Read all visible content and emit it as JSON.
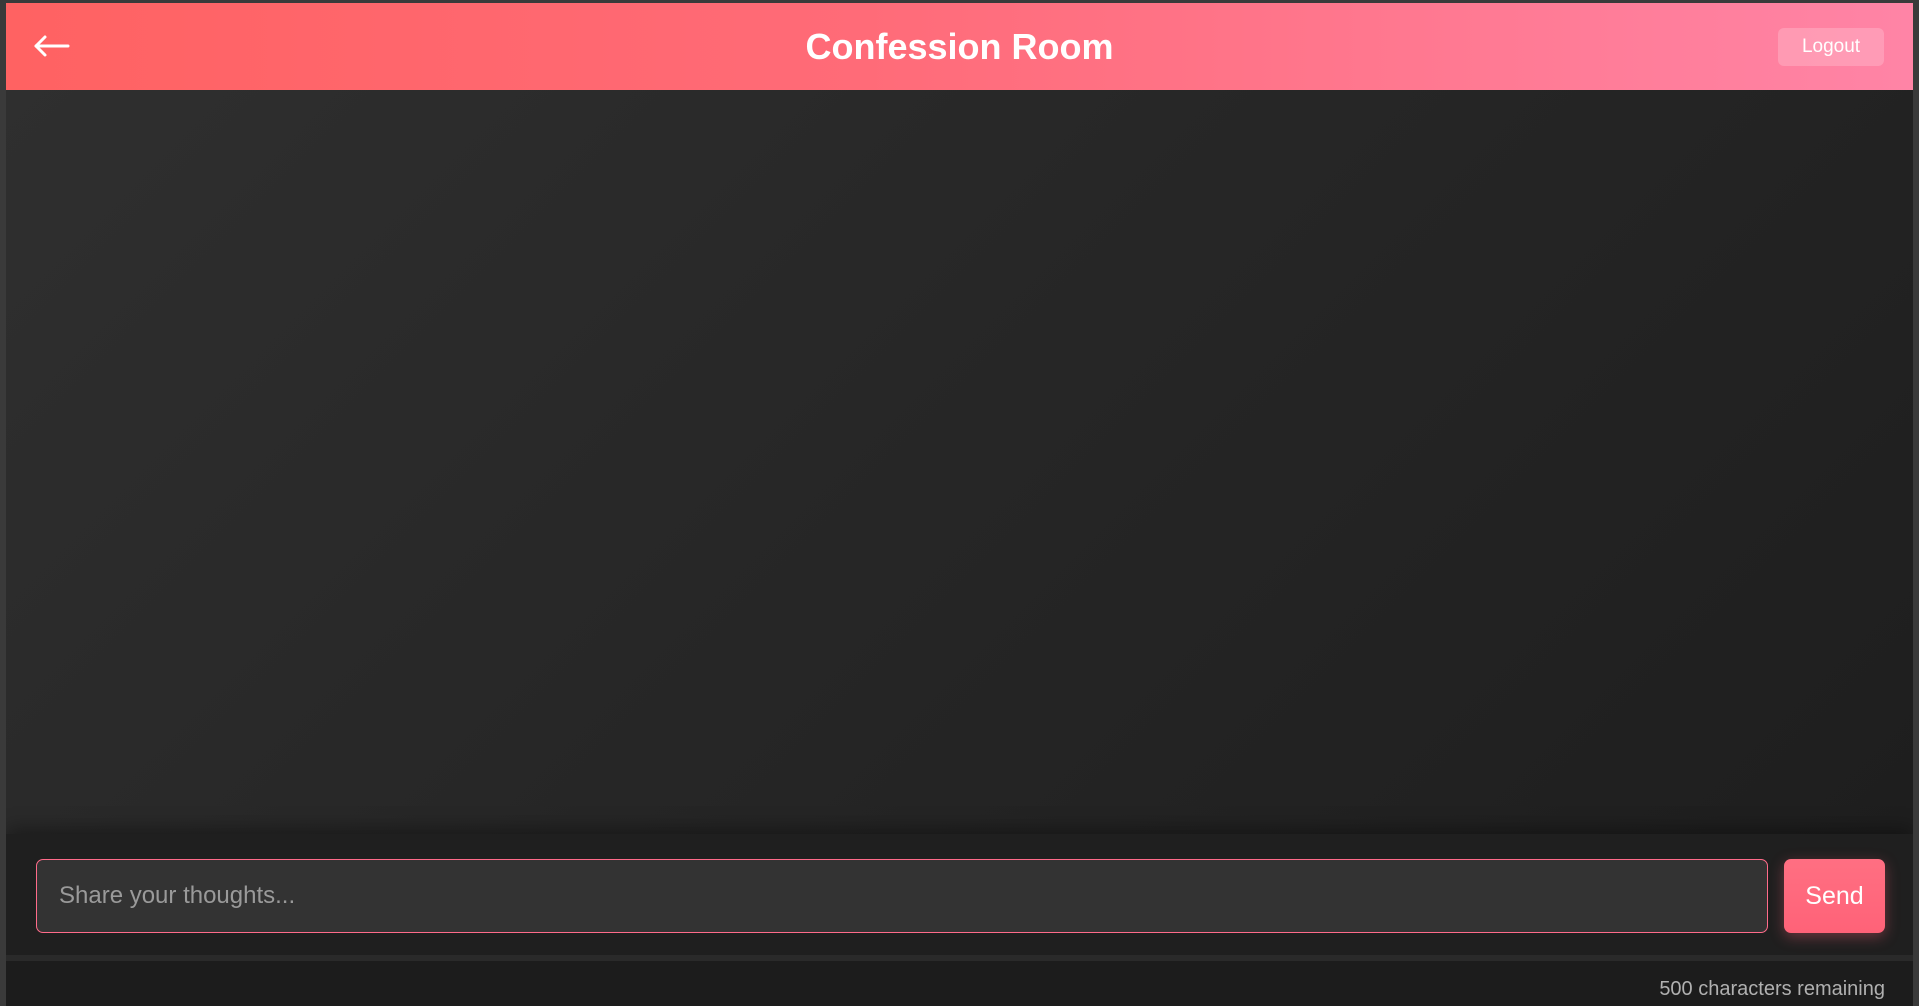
{
  "header": {
    "title": "Confession Room",
    "back_icon": "arrow-left-icon",
    "logout_label": "Logout"
  },
  "composer": {
    "placeholder": "Share your thoughts...",
    "value": "",
    "send_label": "Send"
  },
  "footer": {
    "char_counter": "500 characters remaining"
  },
  "colors": {
    "header_gradient_start": "#ff6262",
    "header_gradient_end": "#ff84a6",
    "accent": "#ff6b8a",
    "background": "#1c1c1c"
  },
  "messages": []
}
